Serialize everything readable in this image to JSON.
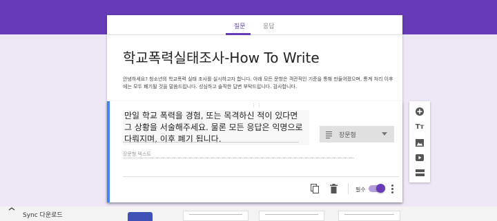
{
  "tabs": {
    "questions": "질문",
    "responses": "응답"
  },
  "form": {
    "title": "학교폭력실태조사-How To Write",
    "description": "안녕하세요? 청소년의 학교폭력 실태 조사를 실시하고자 합니다. 아래 모든 문항은 객관적인 기준을 통해 만들어졌으며, 통계 처리 이후에는 모두 폐기될 것을 말씀드립니다. 성심하고 솔직한 답변 부탁드립니다. 감사합니다."
  },
  "question": {
    "text": "만일 학교 폭력을 경험, 또는 목격하신 적이 있다면 그 상황을 서술해주세요. 물론 모든 응답은 익명으로 다뤄지며, 이후 폐기 됩니다.",
    "type_label": "장문형",
    "answer_placeholder": "장문형 텍스트",
    "required_label": "필수",
    "required_on": true
  },
  "toolbar": {
    "add_icon": "add-circle-icon",
    "title_icon_text": "Tт",
    "image_icon": "image-icon",
    "video_icon": "video-icon",
    "section_icon": "section-icon"
  },
  "bottom": {
    "sync_label": "Sync 다운로드"
  },
  "colors": {
    "accent": "#673ab7",
    "background": "#ede7f6",
    "question_border": "#4285f4"
  }
}
